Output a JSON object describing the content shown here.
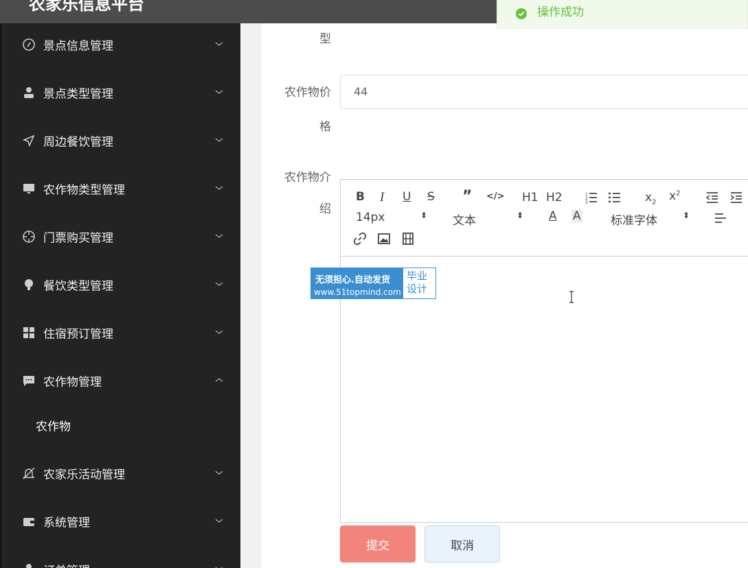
{
  "header": {
    "title": "农家乐信息平台"
  },
  "toast": {
    "message": "操作成功"
  },
  "sidebar": {
    "items": [
      {
        "label": "景点信息管理",
        "icon": "compass-icon"
      },
      {
        "label": "景点类型管理",
        "icon": "user-icon"
      },
      {
        "label": "周边餐饮管理",
        "icon": "send-icon"
      },
      {
        "label": "农作物类型管理",
        "icon": "monitor-icon"
      },
      {
        "label": "门票购买管理",
        "icon": "target-icon"
      },
      {
        "label": "餐饮类型管理",
        "icon": "bulb-icon"
      },
      {
        "label": "住宿预订管理",
        "icon": "grid-icon"
      },
      {
        "label": "农作物管理",
        "icon": "chat-icon"
      },
      {
        "label": "农家乐活动管理",
        "icon": "bell-off-icon"
      },
      {
        "label": "系统管理",
        "icon": "wallet-icon"
      },
      {
        "label": "订单管理",
        "icon": "user-icon"
      }
    ],
    "submenu": {
      "label": "农作物"
    }
  },
  "form": {
    "type_label_tail": "型",
    "price_label_line1": "农作物价",
    "price_label_line2": "格",
    "price_value": "44",
    "intro_label_line1": "农作物介",
    "intro_label_line2": "绍"
  },
  "editor": {
    "font_size": "14px",
    "block_type": "文本",
    "font_family": "标准字体",
    "h1": "H1",
    "h2": "H2"
  },
  "watermark": {
    "line1": "无须担心.自动发货",
    "line2": "www.51topmind.com",
    "right1": "毕业",
    "right2": "设计"
  },
  "buttons": {
    "submit": "提交",
    "cancel": "取消"
  },
  "colors": {
    "sidebar_bg": "#232323",
    "submit_bg": "#f3847c",
    "success": "#67c23a"
  }
}
